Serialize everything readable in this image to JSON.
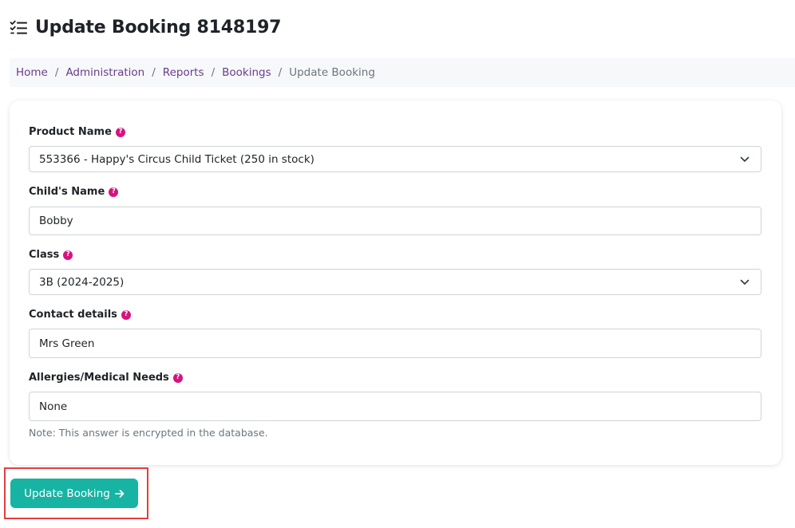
{
  "header": {
    "title_icon": "checklist-icon",
    "title": "Update Booking 8148197"
  },
  "breadcrumb": {
    "items": [
      "Home",
      "Administration",
      "Reports",
      "Bookings"
    ],
    "current": "Update Booking",
    "separator": "/"
  },
  "form": {
    "product": {
      "label": "Product Name",
      "value": "553366 - Happy's Circus Child Ticket (250 in stock)"
    },
    "child_name": {
      "label": "Child's Name",
      "value": "Bobby"
    },
    "class": {
      "label": "Class",
      "value": "3B (2024-2025)"
    },
    "contact": {
      "label": "Contact details",
      "value": "Mrs Green"
    },
    "allergies": {
      "label": "Allergies/Medical Needs",
      "value": "None",
      "note": "Note: This answer is encrypted in the database."
    },
    "help_glyph": "?"
  },
  "actions": {
    "update_label": "Update Booking"
  },
  "colors": {
    "accent": "#17b3a3",
    "link": "#6a3c8c",
    "help_badge": "#d6137f",
    "highlight": "#e53e3e"
  }
}
